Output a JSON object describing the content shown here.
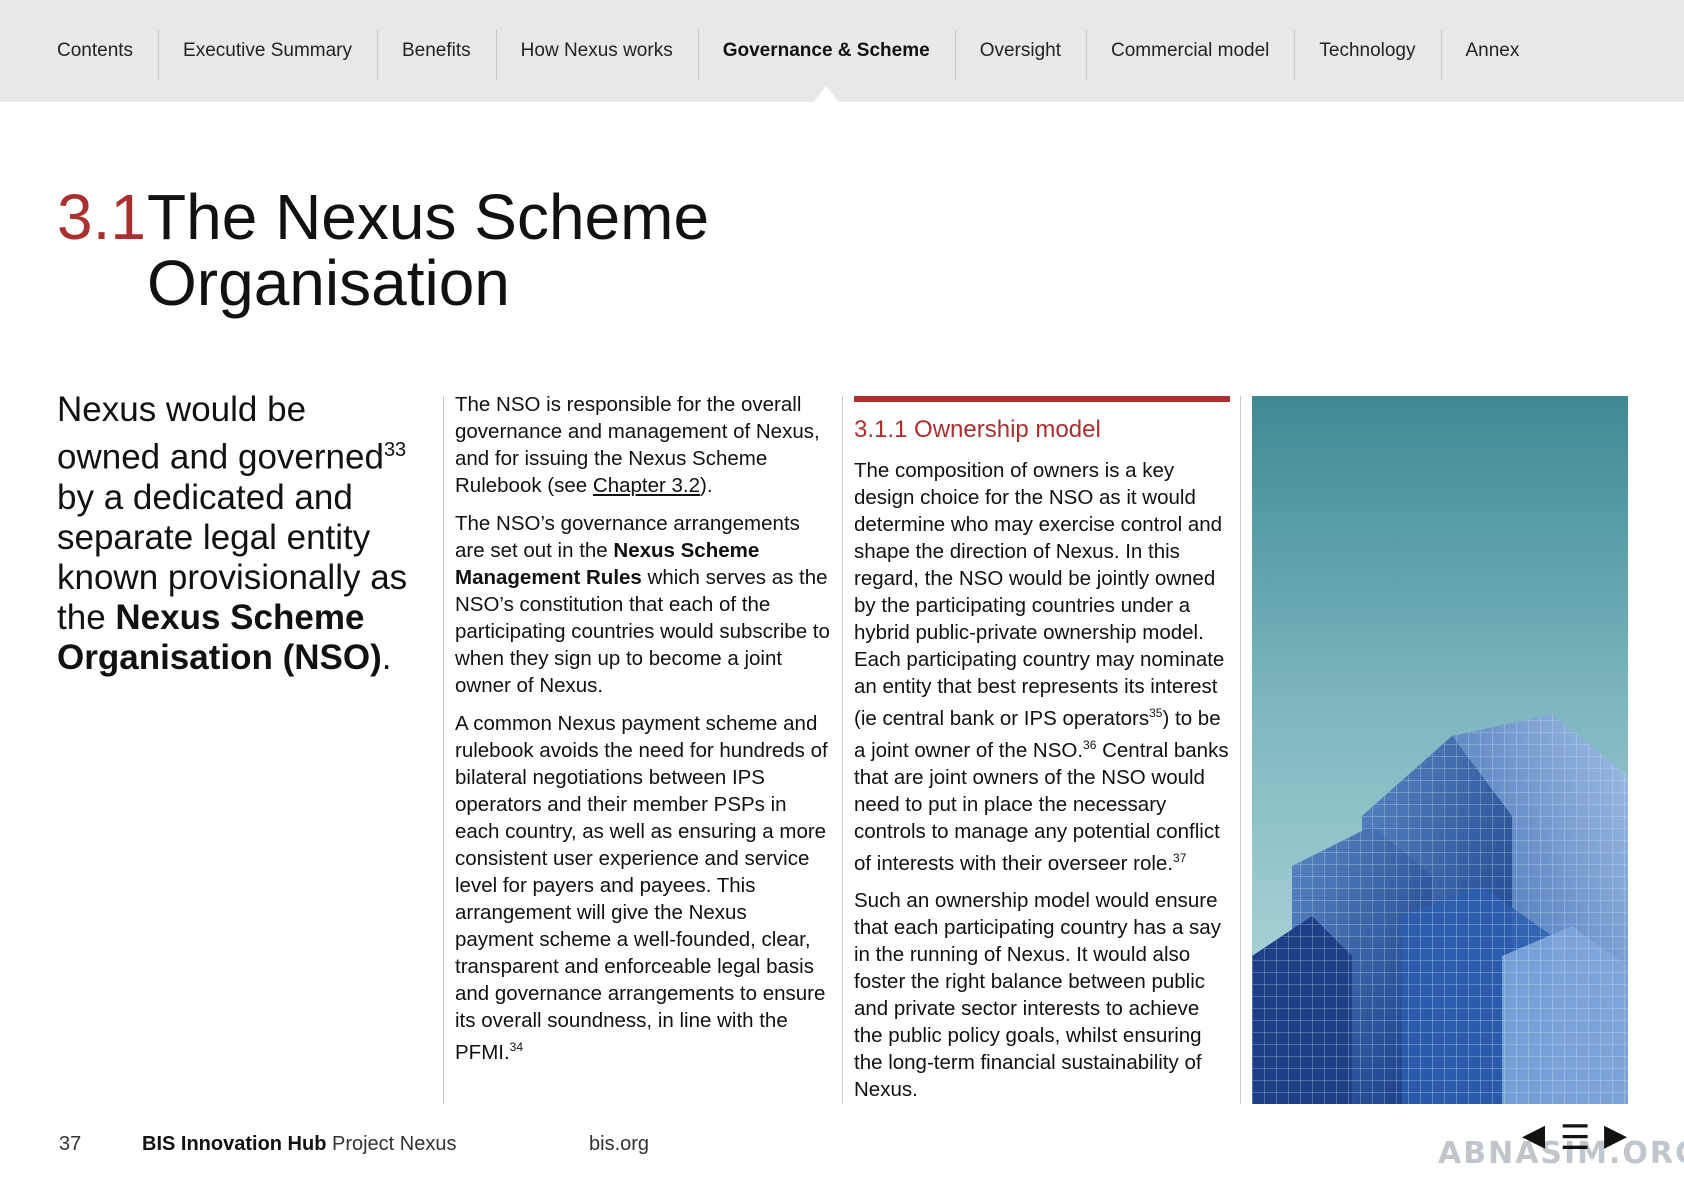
{
  "nav": {
    "items": [
      {
        "label": "Contents"
      },
      {
        "label": "Executive Summary"
      },
      {
        "label": "Benefits"
      },
      {
        "label": "How Nexus works"
      },
      {
        "label": "Governance & Scheme"
      },
      {
        "label": "Oversight"
      },
      {
        "label": "Commercial model"
      },
      {
        "label": "Technology"
      },
      {
        "label": "Annex"
      }
    ],
    "active": "Governance & Scheme"
  },
  "title": {
    "number": "3.1",
    "line1": "The Nexus Scheme",
    "line2": "Organisation"
  },
  "intro": {
    "pre": "Nexus would be owned and governed",
    "footnote": "33",
    "mid": " by a dedicated and separate legal entity known provisionally as the ",
    "bold": "Nexus Scheme Organisation (NSO)",
    "end": "."
  },
  "col2": {
    "p1_pre": "The NSO is responsible for the overall governance and management of Nexus, and for issuing the Nexus Scheme Rulebook (see ",
    "p1_link": "Chapter 3.2",
    "p1_post": ").",
    "p2_pre": "The NSO’s governance arrangements are set out in the ",
    "p2_bold": "Nexus Scheme Management Rules",
    "p2_post": " which serves as the NSO’s constitution that each of the participating countries would subscribe to when they sign up to become a joint owner of Nexus.",
    "p3": "A common Nexus payment scheme and rulebook avoids the need for hundreds of bilateral negotiations between IPS operators and their member PSPs in each country, as well as ensuring a more consistent user experience and service level for payers and payees. This arrangement will give the Nexus payment scheme a well-founded, clear, transparent and enforceable legal basis and governance arrangements to ensure its overall soundness, in line with the PFMI.",
    "p3_fn": "34"
  },
  "col3": {
    "heading": "3.1.1 Ownership model",
    "p1_a": "The composition of owners is a key design choice for the NSO as it would determine who may exercise control and shape the direction of Nexus. In this regard, the NSO would be jointly owned by the participating countries under a hybrid public-private ownership model. Each participating country may nominate an entity that best represents its interest (ie central bank or IPS operators",
    "p1_fn1": "35",
    "p1_b": ") to be a joint owner of the NSO.",
    "p1_fn2": "36",
    "p1_c": " Central banks that are joint owners of the NSO would need to put in place the necessary controls to manage any potential conflict of interests with their overseer role.",
    "p1_fn3": "37",
    "p2": "Such an ownership model would ensure that each participating country has a say in the running of Nexus. It would also foster the right balance between public and private sector interests to achieve the public policy goals, whilst ensuring the long-term financial sustainability of Nexus."
  },
  "footer": {
    "page": "37",
    "org_bold": "BIS Innovation Hub",
    "org_rest": " Project Nexus",
    "site": "bis.org"
  },
  "watermark": "ABNASIM.ORG",
  "controls": {
    "prev_icon": "◀",
    "menu_icon": "☰",
    "next_icon": "▶"
  },
  "colors": {
    "accent": "#a9302e",
    "nav_bg": "#e8e8e8"
  }
}
